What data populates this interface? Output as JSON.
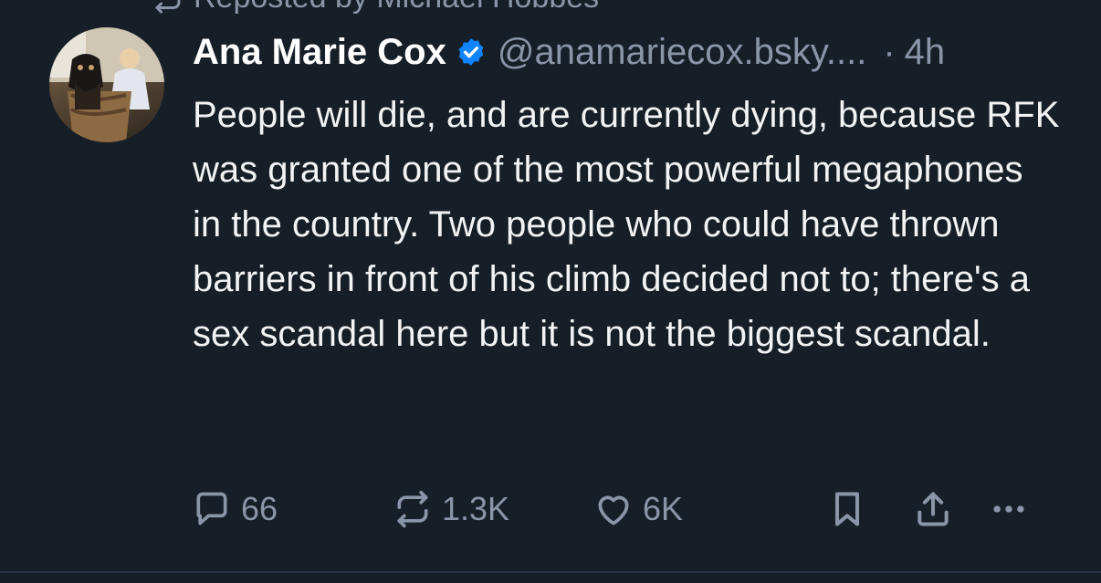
{
  "repost": {
    "label": "Reposted by Michael Hobbes",
    "icon": "repost-icon"
  },
  "post": {
    "author": {
      "display_name": "Ana Marie Cox",
      "handle": "@anamariecox.bsky....",
      "verified": true,
      "avatar_icon": "avatar"
    },
    "separator": "·",
    "time": "4h",
    "text": "People will die, and are currently dying, because RFK was granted one of the most powerful megaphones in the country. Two people who could have thrown barriers in front of his climb decided not to; there's a sex scandal here but it is not the biggest scandal.",
    "actions": {
      "reply": {
        "icon": "reply-icon",
        "count": "66"
      },
      "repost": {
        "icon": "repost-icon",
        "count": "1.3K"
      },
      "like": {
        "icon": "heart-icon",
        "count": "6K"
      },
      "bookmark": {
        "icon": "bookmark-icon"
      },
      "share": {
        "icon": "share-icon"
      },
      "more": {
        "icon": "more-icon"
      }
    }
  },
  "colors": {
    "background": "#161e27",
    "muted_text": "#8a96a8",
    "verified_blue": "#1083fe",
    "text": "#f1f3f5"
  }
}
